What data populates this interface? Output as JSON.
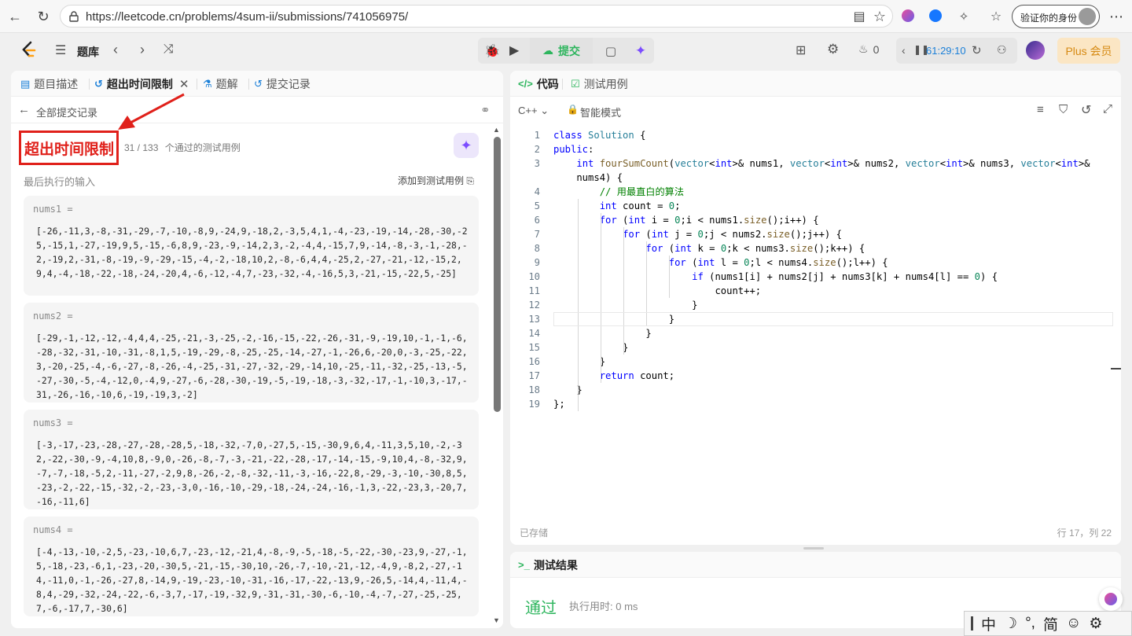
{
  "browser": {
    "url": "https://leetcode.cn/problems/4sum-ii/submissions/741056975/",
    "profile_label": "验证你的身份"
  },
  "toolbar": {
    "problems_label": "题库",
    "submit_label": "提交",
    "streak_count": "0",
    "timer": "61:29:10",
    "plus_label": "Plus 会员"
  },
  "left": {
    "tabs": [
      {
        "label": "题目描述",
        "icon": "document-icon"
      },
      {
        "label": "超出时间限制",
        "icon": "history-icon"
      },
      {
        "label": "题解",
        "icon": "flask-icon"
      },
      {
        "label": "提交记录",
        "icon": "history-icon"
      }
    ],
    "back_label": "全部提交记录",
    "status": "超出时间限制",
    "passed": "31 / 133",
    "passed_suffix": "个通过的测试用例",
    "last_input_label": "最后执行的输入",
    "add_case_label": "添加到测试用例",
    "inputs": [
      {
        "name": "nums1 =",
        "value": "[-26,-11,3,-8,-31,-29,-7,-10,-8,9,-24,9,-18,2,-3,5,4,1,-4,-23,-19,-14,-28,-30,-25,-15,1,-27,-19,9,5,-15,-6,8,9,-23,-9,-14,2,3,-2,-4,4,-15,7,9,-14,-8,-3,-1,-28,-2,-19,2,-31,-8,-19,-9,-29,-15,-4,-2,-18,10,2,-8,-6,4,4,-25,2,-27,-21,-12,-15,2,9,4,-4,-18,-22,-18,-24,-20,4,-6,-12,-4,7,-23,-32,-4,-16,5,3,-21,-15,-22,5,-25]"
      },
      {
        "name": "nums2 =",
        "value": "[-29,-1,-12,-12,-4,4,4,-25,-21,-3,-25,-2,-16,-15,-22,-26,-31,-9,-19,10,-1,-1,-6,-28,-32,-31,-10,-31,-8,1,5,-19,-29,-8,-25,-25,-14,-27,-1,-26,6,-20,0,-3,-25,-22,3,-20,-25,-4,-6,-27,-8,-26,-4,-25,-31,-27,-32,-29,-14,10,-25,-11,-32,-25,-13,-5,-27,-30,-5,-4,-12,0,-4,9,-27,-6,-28,-30,-19,-5,-19,-18,-3,-32,-17,-1,-10,3,-17,-31,-26,-16,-10,6,-19,-19,3,-2]"
      },
      {
        "name": "nums3 =",
        "value": "[-3,-17,-23,-28,-27,-28,-28,5,-18,-32,-7,0,-27,5,-15,-30,9,6,4,-11,3,5,10,-2,-32,-22,-30,-9,-4,10,8,-9,0,-26,-8,-7,-3,-21,-22,-28,-17,-14,-15,-9,10,4,-8,-32,9,-7,-7,-18,-5,2,-11,-27,-2,9,8,-26,-2,-8,-32,-11,-3,-16,-22,8,-29,-3,-10,-30,8,5,-23,-2,-22,-15,-32,-2,-23,-3,0,-16,-10,-29,-18,-24,-24,-16,-1,3,-22,-23,3,-20,7,-16,-11,6]"
      },
      {
        "name": "nums4 =",
        "value": "[-4,-13,-10,-2,5,-23,-10,6,7,-23,-12,-21,4,-8,-9,-5,-18,-5,-22,-30,-23,9,-27,-1,5,-18,-23,-6,1,-23,-20,-30,5,-21,-15,-30,10,-26,-7,-10,-21,-12,-4,9,-8,2,-27,-14,-11,0,-1,-26,-27,8,-14,9,-19,-23,-10,-31,-16,-17,-22,-13,9,-26,5,-14,4,-11,4,-8,4,-29,-32,-24,-22,-6,-3,7,-17,-19,-32,9,-31,-31,-30,-6,-10,-4,-7,-27,-25,-25,7,-6,-17,7,-30,6]"
      }
    ]
  },
  "right": {
    "tabs": [
      {
        "label": "代码",
        "icon": "code-icon"
      },
      {
        "label": "测试用例",
        "icon": "checkbox-icon"
      }
    ],
    "language": "C++",
    "mode": "智能模式",
    "code_lines": [
      "class Solution {",
      "public:",
      "    int fourSumCount(vector<int>& nums1, vector<int>& nums2, vector<int>& nums3, vector<int>&",
      "    nums4) {",
      "        // 用最直白的算法",
      "        int count = 0;",
      "        for (int i = 0;i < nums1.size();i++) {",
      "            for (int j = 0;j < nums2.size();j++) {",
      "                for (int k = 0;k < nums3.size();k++) {",
      "                    for (int l = 0;l < nums4.size();l++) {",
      "                        if (nums1[i] + nums2[j] + nums3[k] + nums4[l] == 0) {",
      "                            count++;",
      "                        }",
      "                    }",
      "                }",
      "            }",
      "        }",
      "        return count;",
      "    }",
      "};"
    ],
    "line_numbers": [
      "1",
      "2",
      "3",
      "",
      "4",
      "5",
      "6",
      "7",
      "8",
      "9",
      "10",
      "11",
      "12",
      "13",
      "14",
      "15",
      "16",
      "17",
      "18",
      "19"
    ],
    "saved_label": "已存储",
    "cursor_pos": "行 17，列 22"
  },
  "result": {
    "title": "测试结果",
    "status": "通过",
    "exec_time": "执行用时: 0 ms"
  },
  "ime": {
    "mode": "中",
    "punct": "°,",
    "script": "简"
  }
}
